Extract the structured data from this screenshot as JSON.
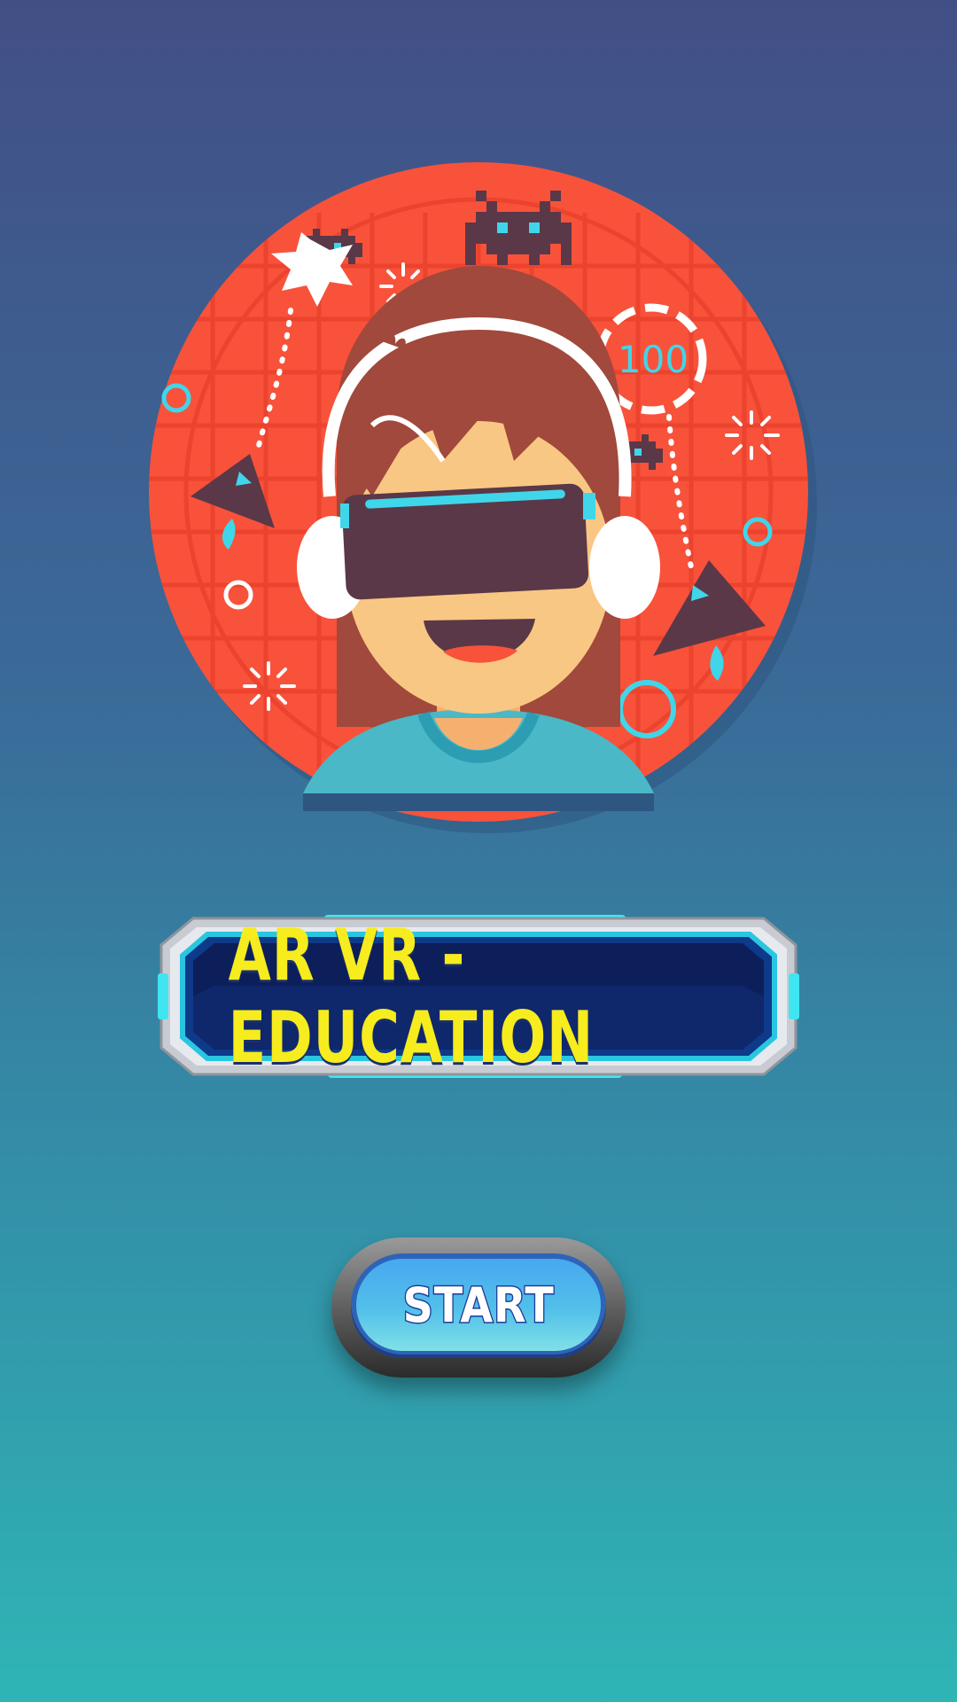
{
  "app": {
    "screen": "splash",
    "colors": {
      "bg_top": "#424f86",
      "bg_bottom": "#2fb5b5",
      "hero_circle": "#f8523b",
      "title_yellow": "#f6ec1e",
      "banner_dark": "#0c1f5a",
      "accent_cyan": "#3fd6ea"
    }
  },
  "hero": {
    "icon": "vr-headset-girl-illustration",
    "score_text": "100"
  },
  "banner": {
    "title": "AR VR - EDUCATION"
  },
  "start_button": {
    "label": "START"
  }
}
